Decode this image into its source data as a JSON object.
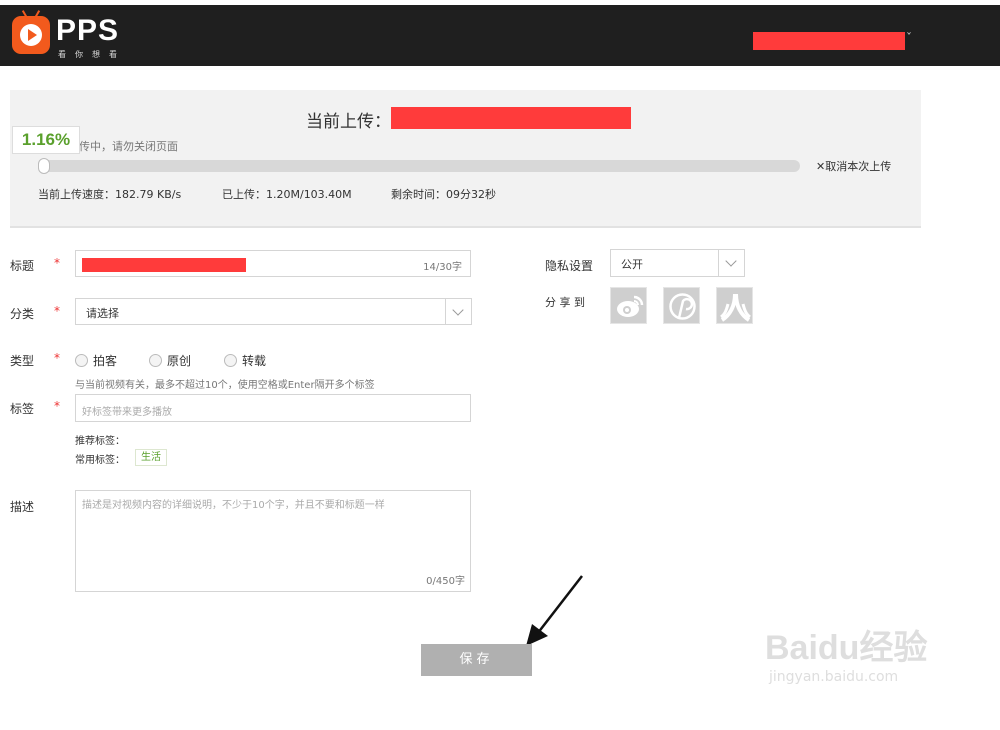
{
  "header": {
    "logo_text": "PPS",
    "slogan": "看你想看"
  },
  "upload": {
    "title_label": "当前上传：",
    "progress_percent": "1.16%",
    "progress_value": 1.16,
    "hint": "上传中，请勿关闭页面",
    "cancel_label": "✕取消本次上传",
    "speed": "当前上传速度：182.79 KB/s",
    "uploaded": "已上传：1.20M/103.40M",
    "remaining": "剩余时间：09分32秒"
  },
  "form": {
    "title": {
      "label": "标题",
      "required": "*",
      "counter": "14/30字"
    },
    "category": {
      "label": "分类",
      "required": "*",
      "selected": "请选择"
    },
    "type": {
      "label": "类型",
      "required": "*",
      "options": [
        "拍客",
        "原创",
        "转载"
      ]
    },
    "tags": {
      "label": "标签",
      "required": "*",
      "hint": "与当前视频有关，最多不超过10个，使用空格或Enter隔开多个标签",
      "placeholder": "好标签带来更多播放",
      "recommended_label": "推荐标签：",
      "common_label": "常用标签：",
      "common_tags": [
        "生活"
      ]
    },
    "description": {
      "label": "描述",
      "placeholder": "描述是对视频内容的详细说明，不少于10个字，并且不要和标题一样",
      "counter": "0/450字"
    },
    "privacy": {
      "label": "隐私设置",
      "selected": "公开"
    },
    "share": {
      "label": "分 享 到",
      "icons": [
        "weibo-icon",
        "qzone-icon",
        "renren-icon"
      ]
    },
    "save_label": "保存"
  },
  "watermark": {
    "main": "Baidu经验",
    "sub": "jingyan.baidu.com"
  }
}
